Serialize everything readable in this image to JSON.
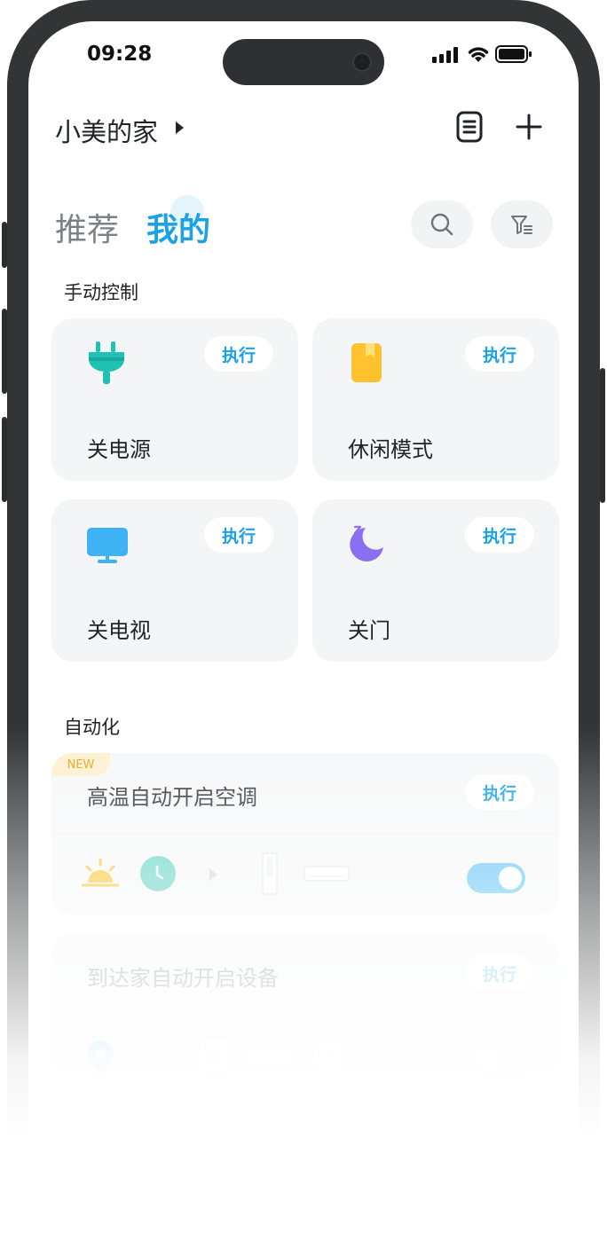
{
  "status_bar": {
    "time": "09:28"
  },
  "header": {
    "home_name": "小美的家"
  },
  "tabs": [
    {
      "label": "推荐",
      "active": false
    },
    {
      "label": "我的",
      "active": true
    }
  ],
  "sections": {
    "manual": "手动控制",
    "automation": "自动化"
  },
  "manual_scenes": [
    {
      "label": "关电源",
      "action": "执行",
      "icon": "plug-icon"
    },
    {
      "label": "休闲模式",
      "action": "执行",
      "icon": "book-icon"
    },
    {
      "label": "关电视",
      "action": "执行",
      "icon": "tv-icon"
    },
    {
      "label": "关门",
      "action": "执行",
      "icon": "moon-icon"
    }
  ],
  "automations": [
    {
      "title": "高温自动开启空调",
      "action": "执行",
      "badge": "NEW",
      "enabled": true
    },
    {
      "title": "到达家自动开启设备",
      "action": "执行",
      "enabled": false
    }
  ],
  "colors": {
    "accent": "#1aa1e6",
    "toggle_on": "#5ec4f7",
    "card_bg": "#f4f5f7"
  }
}
